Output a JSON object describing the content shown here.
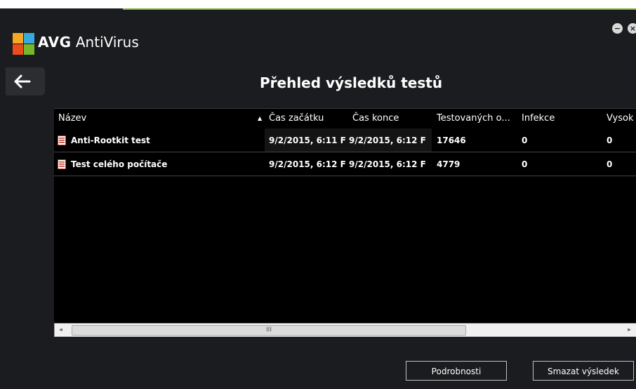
{
  "app": {
    "brand": "AVG",
    "name": "AntiVirus"
  },
  "window_controls": {
    "minimize_glyph": "−",
    "close_glyph": "×"
  },
  "page": {
    "title": "Přehled výsledků testů"
  },
  "table": {
    "columns": [
      "Název",
      "Čas začátku",
      "Čas konce",
      "Testovaných o...",
      "Infekce",
      "Vysok"
    ],
    "sort_indicator": "▲",
    "rows": [
      {
        "name": "Anti-Rootkit test",
        "start": "9/2/2015, 6:11 F",
        "end": "9/2/2015, 6:12 F",
        "tested": "17646",
        "infections": "0",
        "high": "0"
      },
      {
        "name": "Test celého počítače",
        "start": "9/2/2015, 6:12 F",
        "end": "9/2/2015, 6:12 F",
        "tested": "4779",
        "infections": "0",
        "high": "0"
      }
    ]
  },
  "scrollbar": {
    "left": "◂",
    "right": "▸",
    "grip": "III"
  },
  "buttons": {
    "details": "Podrobnosti",
    "delete": "Smazat výsledek"
  },
  "colors": {
    "accent": "#76b82a",
    "background": "#1b1c1f",
    "grid": "#000000"
  }
}
